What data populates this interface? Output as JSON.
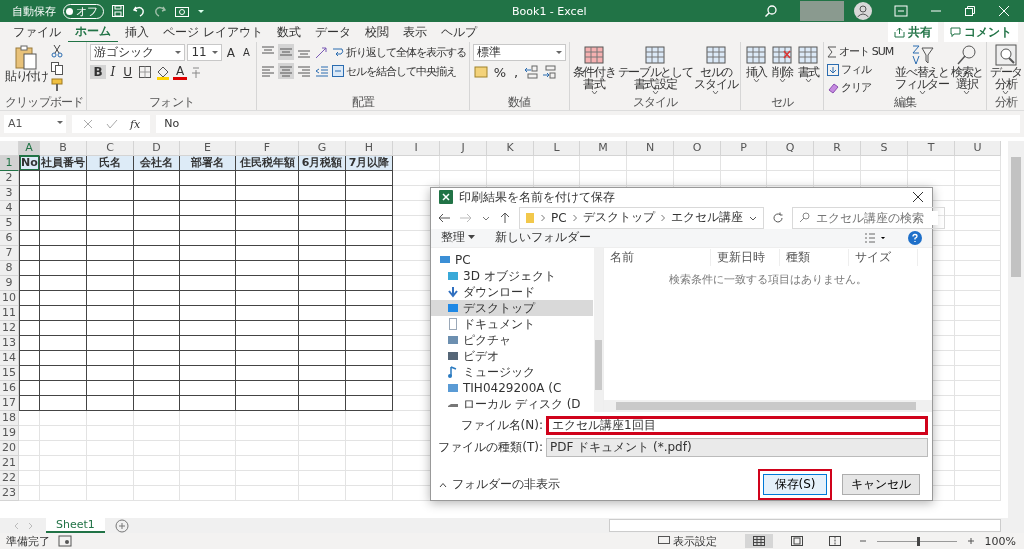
{
  "title_bar": {
    "autosave_label": "自動保存",
    "autosave_toggle": "オフ",
    "autosave_on": false,
    "title": "Book1 - Excel"
  },
  "menu_tabs": [
    {
      "label": "ファイル",
      "selected": false
    },
    {
      "label": "ホーム",
      "selected": true
    },
    {
      "label": "挿入",
      "selected": false
    },
    {
      "label": "ページ レイアウト",
      "selected": false
    },
    {
      "label": "数式",
      "selected": false
    },
    {
      "label": "データ",
      "selected": false
    },
    {
      "label": "校閲",
      "selected": false
    },
    {
      "label": "表示",
      "selected": false
    },
    {
      "label": "ヘルプ",
      "selected": false
    }
  ],
  "share_button": "共有",
  "comment_button": "コメント",
  "ribbon": {
    "groups": [
      {
        "kind": "clipboard",
        "label": "クリップボード",
        "paste": "貼り付け"
      },
      {
        "kind": "font",
        "label": "フォント",
        "font_name": "游ゴシック",
        "font_size": "11",
        "grow": "A",
        "shrink": "A",
        "bold": "B",
        "bold_active": true,
        "italic": "I",
        "underline": "U",
        "color_letter": "A"
      },
      {
        "kind": "alignment",
        "label": "配置",
        "wrap": "折り返して全体を表示する",
        "merge": "セルを結合して中央揃え",
        "middle_active": true,
        "center_active": true
      },
      {
        "kind": "number",
        "label": "数値",
        "format": "標準",
        "percent": "%",
        "comma": ","
      },
      {
        "kind": "styles",
        "label": "スタイル",
        "buttons": [
          {
            "lines": [
              "条件付き",
              "書式"
            ]
          },
          {
            "lines": [
              "テーブルとして",
              "書式設定"
            ]
          },
          {
            "lines": [
              "セルの",
              "スタイル"
            ]
          }
        ]
      },
      {
        "kind": "cells",
        "label": "セル",
        "buttons": [
          {
            "lines": [
              "挿入"
            ]
          },
          {
            "lines": [
              "削除"
            ]
          },
          {
            "lines": [
              "書式"
            ]
          }
        ]
      },
      {
        "kind": "editing",
        "label": "編集",
        "autosum": "オート SUM",
        "fill": "フィル",
        "clear": "クリア",
        "buttons": [
          {
            "lines": [
              "並べ替えと",
              "フィルター"
            ]
          },
          {
            "lines": [
              "検索と",
              "選択"
            ]
          }
        ]
      },
      {
        "kind": "analysis",
        "label": "分析",
        "buttons": [
          {
            "lines": [
              "データ",
              "分析"
            ]
          }
        ]
      }
    ]
  },
  "formula_bar": {
    "cell_ref": "A1",
    "function_label": "fx",
    "value": "No"
  },
  "sheet": {
    "columns": [
      {
        "label": "A",
        "selected": true
      },
      {
        "label": "B",
        "selected": false
      },
      {
        "label": "C",
        "selected": false
      },
      {
        "label": "D",
        "selected": false
      },
      {
        "label": "E",
        "selected": false
      },
      {
        "label": "F",
        "selected": false
      },
      {
        "label": "G",
        "selected": false
      },
      {
        "label": "H",
        "selected": false
      },
      {
        "label": "I",
        "selected": false
      },
      {
        "label": "J",
        "selected": false
      },
      {
        "label": "K",
        "selected": false
      },
      {
        "label": "L",
        "selected": false
      },
      {
        "label": "M",
        "selected": false
      },
      {
        "label": "N",
        "selected": false
      },
      {
        "label": "O",
        "selected": false
      },
      {
        "label": "P",
        "selected": false
      },
      {
        "label": "Q",
        "selected": false
      },
      {
        "label": "R",
        "selected": false
      },
      {
        "label": "S",
        "selected": false
      },
      {
        "label": "T",
        "selected": false
      },
      {
        "label": "U",
        "selected": false
      }
    ],
    "rows": [
      {
        "label": "1",
        "selected": true,
        "bordered": true
      },
      {
        "label": "2",
        "selected": false,
        "bordered": true
      },
      {
        "label": "3",
        "selected": false,
        "bordered": true
      },
      {
        "label": "4",
        "selected": false,
        "bordered": true
      },
      {
        "label": "5",
        "selected": false,
        "bordered": true
      },
      {
        "label": "6",
        "selected": false,
        "bordered": true
      },
      {
        "label": "7",
        "selected": false,
        "bordered": true
      },
      {
        "label": "8",
        "selected": false,
        "bordered": true
      },
      {
        "label": "9",
        "selected": false,
        "bordered": true
      },
      {
        "label": "10",
        "selected": false,
        "bordered": true
      },
      {
        "label": "11",
        "selected": false,
        "bordered": true
      },
      {
        "label": "12",
        "selected": false,
        "bordered": true
      },
      {
        "label": "13",
        "selected": false,
        "bordered": true
      },
      {
        "label": "14",
        "selected": false,
        "bordered": true
      },
      {
        "label": "15",
        "selected": false,
        "bordered": true
      },
      {
        "label": "16",
        "selected": false,
        "bordered": true
      },
      {
        "label": "17",
        "selected": false,
        "bordered": true
      },
      {
        "label": "18",
        "selected": false,
        "bordered": false
      },
      {
        "label": "19",
        "selected": false,
        "bordered": false
      },
      {
        "label": "20",
        "selected": false,
        "bordered": false
      },
      {
        "label": "21",
        "selected": false,
        "bordered": false
      },
      {
        "label": "22",
        "selected": false,
        "bordered": false
      },
      {
        "label": "23",
        "selected": false,
        "bordered": false
      }
    ],
    "header_cells": [
      "No",
      "社員番号",
      "氏名",
      "会社名",
      "部署名",
      "住民税年額",
      "6月税額",
      "7月以降"
    ]
  },
  "dialog": {
    "title": "印刷結果を名前を付けて保存",
    "path": [
      "PC",
      "デスクトップ",
      "エクセル講座"
    ],
    "search_placeholder": "エクセル講座の検索",
    "organize": "整理",
    "new_folder": "新しいフォルダー",
    "nav": [
      {
        "label": "PC",
        "kind": "pc",
        "selected": false,
        "children": [
          {
            "label": "3D オブジェクト",
            "kind": "cube",
            "selected": false
          },
          {
            "label": "ダウンロード",
            "kind": "download",
            "selected": false
          },
          {
            "label": "デスクトップ",
            "kind": "desktop",
            "selected": true
          },
          {
            "label": "ドキュメント",
            "kind": "document",
            "selected": false
          },
          {
            "label": "ピクチャ",
            "kind": "picture",
            "selected": false
          },
          {
            "label": "ビデオ",
            "kind": "video",
            "selected": false
          },
          {
            "label": "ミュージック",
            "kind": "music",
            "selected": false
          },
          {
            "label": "TIH0429200A (C",
            "kind": "drive",
            "selected": false
          },
          {
            "label": "ローカル ディスク (D",
            "kind": "disk",
            "selected": false
          }
        ]
      }
    ],
    "columns": [
      "名前",
      "更新日時",
      "種類",
      "サイズ"
    ],
    "empty_message": "検索条件に一致する項目はありません。",
    "file_name_label": "ファイル名(N):",
    "file_name": "エクセル講座1回目",
    "file_name_highlighted": true,
    "file_type_label": "ファイルの種類(T):",
    "file_type": "PDF ドキュメント (*.pdf)",
    "hide_folders": "フォルダーの非表示",
    "save": "保存(S)",
    "save_highlighted": true,
    "cancel": "キャンセル"
  },
  "sheet_tabs": [
    {
      "label": "Sheet1",
      "selected": true
    }
  ],
  "status_bar": {
    "ready": "準備完了",
    "display_settings": "表示設定",
    "views": [
      {
        "kind": "normal",
        "selected": true
      },
      {
        "kind": "page_layout",
        "selected": false
      },
      {
        "kind": "page_break",
        "selected": false
      }
    ],
    "zoom": "100%",
    "level": 0.5
  }
}
